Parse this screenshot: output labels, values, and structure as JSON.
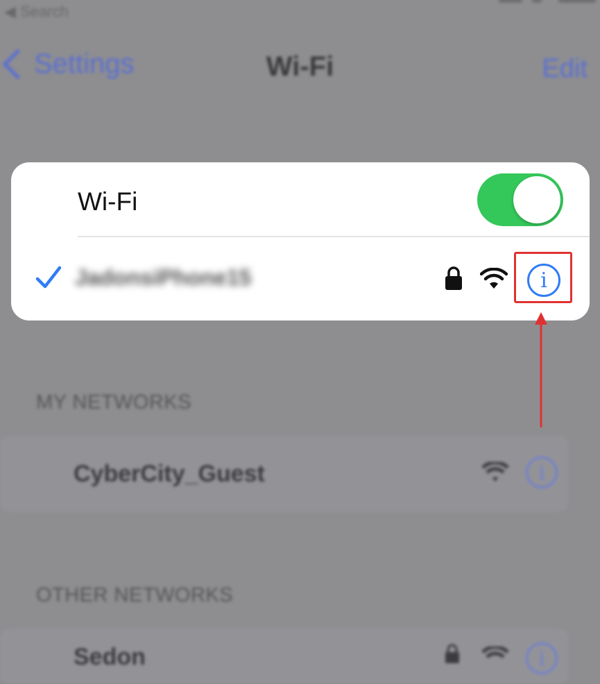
{
  "status_bar": {
    "back_label": "◀ Search"
  },
  "nav": {
    "back_label": "Settings",
    "title": "Wi-Fi",
    "edit_label": "Edit"
  },
  "wifi_card": {
    "toggle_label": "Wi-Fi",
    "toggle_on": true,
    "connected_network": "JadonsiPhone15",
    "icons": [
      "checkmark-icon",
      "lock-icon",
      "wifi-signal-icon",
      "info-icon"
    ]
  },
  "my_networks": {
    "header": "MY NETWORKS",
    "items": [
      {
        "name": "CyberCity_Guest"
      }
    ]
  },
  "other_networks": {
    "header": "OTHER NETWORKS",
    "items": [
      {
        "name": "Sedon"
      }
    ]
  },
  "colors": {
    "toggle_on": "#34c759",
    "accent_blue": "#2f7cf6",
    "highlight_red": "#e03131"
  }
}
